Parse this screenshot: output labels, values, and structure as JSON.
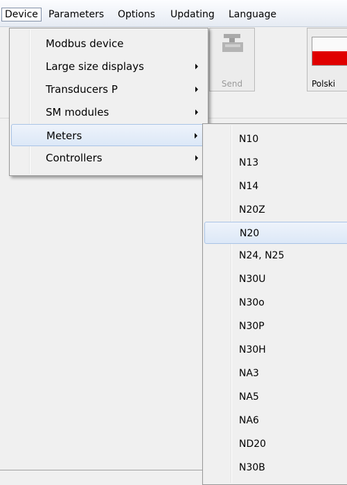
{
  "menubar": {
    "items": [
      {
        "label": "Device",
        "active": true
      },
      {
        "label": "Parameters"
      },
      {
        "label": "Options"
      },
      {
        "label": "Updating"
      },
      {
        "label": "Language"
      }
    ]
  },
  "toolbar": {
    "send_label": "Send",
    "polski_label": "Polski"
  },
  "device_menu": {
    "items": [
      {
        "label": "Modbus device",
        "submenu": false
      },
      {
        "label": "Large size displays",
        "submenu": true
      },
      {
        "label": "Transducers P",
        "submenu": true
      },
      {
        "label": "SM modules",
        "submenu": true
      },
      {
        "label": "Meters",
        "submenu": true,
        "highlighted": true
      },
      {
        "label": "Controllers",
        "submenu": true
      }
    ]
  },
  "meters_menu": {
    "items": [
      "N10",
      "N13",
      "N14",
      "N20Z",
      "N20",
      "N24, N25",
      "N30U",
      "N30o",
      "N30P",
      "N30H",
      "NA3",
      "NA5",
      "NA6",
      "ND20",
      "N30B"
    ],
    "highlighted": "N20"
  },
  "colors": {
    "flag_white": "#fafafa",
    "flag_red": "#e00000",
    "highlight_border": "#a8c3e6"
  }
}
